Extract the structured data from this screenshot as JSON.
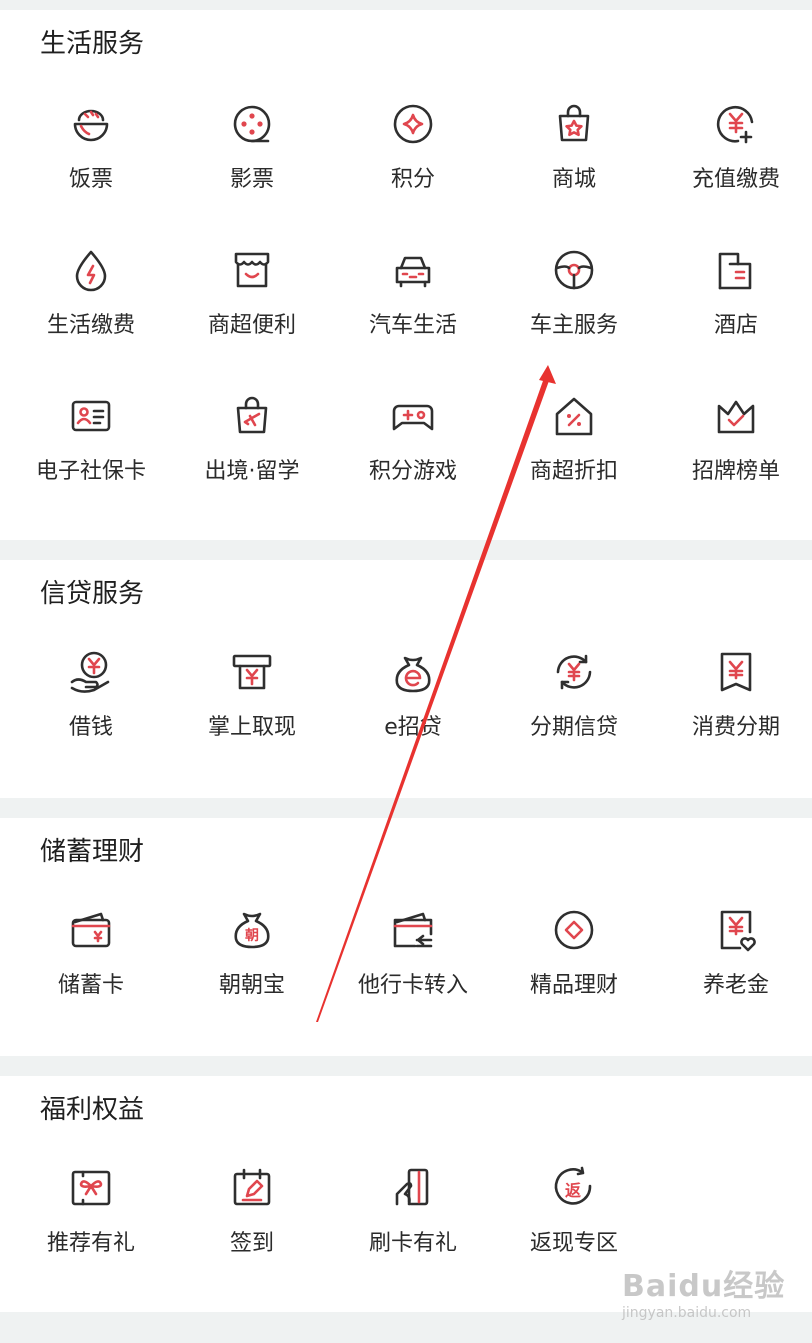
{
  "sections": [
    {
      "title": "生活服务",
      "items": [
        {
          "label": "饭票",
          "icon": "rice-bowl-icon"
        },
        {
          "label": "影票",
          "icon": "film-reel-icon"
        },
        {
          "label": "积分",
          "icon": "points-star-icon"
        },
        {
          "label": "商城",
          "icon": "shopping-bag-icon"
        },
        {
          "label": "充值缴费",
          "icon": "yuan-plus-icon"
        },
        {
          "label": "生活缴费",
          "icon": "water-drop-bolt-icon"
        },
        {
          "label": "商超便利",
          "icon": "storefront-icon"
        },
        {
          "label": "汽车生活",
          "icon": "car-icon"
        },
        {
          "label": "车主服务",
          "icon": "steering-wheel-icon"
        },
        {
          "label": "酒店",
          "icon": "hotel-building-icon"
        },
        {
          "label": "电子社保卡",
          "icon": "id-card-icon"
        },
        {
          "label": "出境·留学",
          "icon": "travel-bag-plane-icon"
        },
        {
          "label": "积分游戏",
          "icon": "gamepad-icon"
        },
        {
          "label": "商超折扣",
          "icon": "house-percent-icon"
        },
        {
          "label": "招牌榜单",
          "icon": "crown-check-icon"
        }
      ]
    },
    {
      "title": "信贷服务",
      "items": [
        {
          "label": "借钱",
          "icon": "hand-coin-icon"
        },
        {
          "label": "掌上取现",
          "icon": "atm-cash-icon"
        },
        {
          "label": "e招贷",
          "icon": "money-bag-e-icon"
        },
        {
          "label": "分期信贷",
          "icon": "cycle-yuan-icon"
        },
        {
          "label": "消费分期",
          "icon": "bill-yuan-icon"
        }
      ]
    },
    {
      "title": "储蓄理财",
      "items": [
        {
          "label": "储蓄卡",
          "icon": "debit-card-icon"
        },
        {
          "label": "朝朝宝",
          "icon": "money-bag-zhao-icon"
        },
        {
          "label": "他行卡转入",
          "icon": "card-transfer-icon"
        },
        {
          "label": "精品理财",
          "icon": "coin-diamond-icon"
        },
        {
          "label": "养老金",
          "icon": "pension-doc-heart-icon"
        }
      ]
    },
    {
      "title": "福利权益",
      "items": [
        {
          "label": "推荐有礼",
          "icon": "gift-card-icon"
        },
        {
          "label": "签到",
          "icon": "calendar-sign-icon"
        },
        {
          "label": "刷卡有礼",
          "icon": "hand-card-icon"
        },
        {
          "label": "返现专区",
          "icon": "cashback-fan-icon"
        }
      ]
    }
  ],
  "watermark": {
    "main": "Baidu经验",
    "sub": "jingyan.baidu.com"
  },
  "colors": {
    "accent": "#e0464e",
    "stroke": "#2f2f2f",
    "background": "#eff2f2",
    "arrow": "#e8322f"
  }
}
